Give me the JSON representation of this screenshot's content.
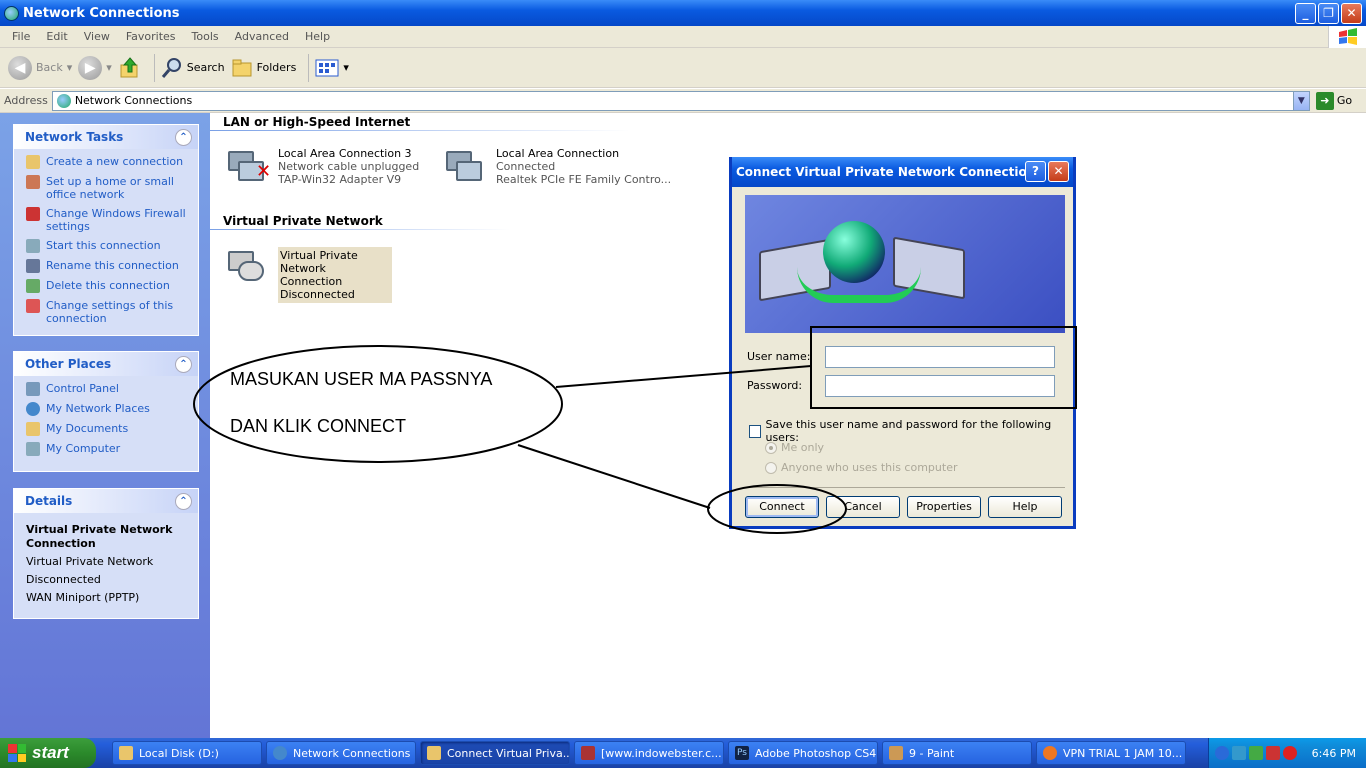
{
  "window": {
    "title": "Network Connections"
  },
  "menu": [
    "File",
    "Edit",
    "View",
    "Favorites",
    "Tools",
    "Advanced",
    "Help"
  ],
  "toolbar": {
    "back": "Back",
    "search": "Search",
    "folders": "Folders"
  },
  "address": {
    "label": "Address",
    "value": "Network Connections",
    "go": "Go"
  },
  "sidebar": {
    "network_tasks": {
      "title": "Network Tasks",
      "items": [
        "Create a new connection",
        "Set up a home or small office network",
        "Change Windows Firewall settings",
        "Start this connection",
        "Rename this connection",
        "Delete this connection",
        "Change settings of this connection"
      ]
    },
    "other_places": {
      "title": "Other Places",
      "items": [
        "Control Panel",
        "My Network Places",
        "My Documents",
        "My Computer"
      ]
    },
    "details": {
      "title": "Details",
      "name": "Virtual Private Network Connection",
      "type": "Virtual Private Network",
      "status": "Disconnected",
      "device": "WAN Miniport (PPTP)"
    }
  },
  "groups": {
    "lan": {
      "title": "LAN or High-Speed Internet",
      "items": [
        {
          "name": "Local Area Connection 3",
          "status": "Network cable unplugged",
          "device": "TAP-Win32 Adapter V9"
        },
        {
          "name": "Local Area Connection",
          "status": "Connected",
          "device": "Realtek PCIe FE Family Contro..."
        }
      ]
    },
    "vpn": {
      "title": "Virtual Private Network",
      "items": [
        {
          "name": "Virtual Private Network Connection",
          "status": "Disconnected"
        }
      ]
    }
  },
  "dialog": {
    "title": "Connect Virtual Private Network Connection",
    "username_label": "User name:",
    "password_label": "Password:",
    "save_label": "Save this user name and password for the following users:",
    "radio_me": "Me only",
    "radio_anyone": "Anyone who uses this computer",
    "connect": "Connect",
    "cancel": "Cancel",
    "properties": "Properties",
    "help": "Help"
  },
  "annotation": {
    "line1": "MASUKAN USER MA PASSNYA",
    "line2": "DAN KLIK CONNECT"
  },
  "taskbar": {
    "start": "start",
    "tasks": [
      "Local Disk (D:)",
      "Network Connections",
      "Connect Virtual Priva...",
      "[www.indowebster.c...",
      "Adobe Photoshop CS4",
      "9 - Paint",
      "VPN TRIAL 1 JAM 10..."
    ],
    "clock": "6:46 PM"
  }
}
